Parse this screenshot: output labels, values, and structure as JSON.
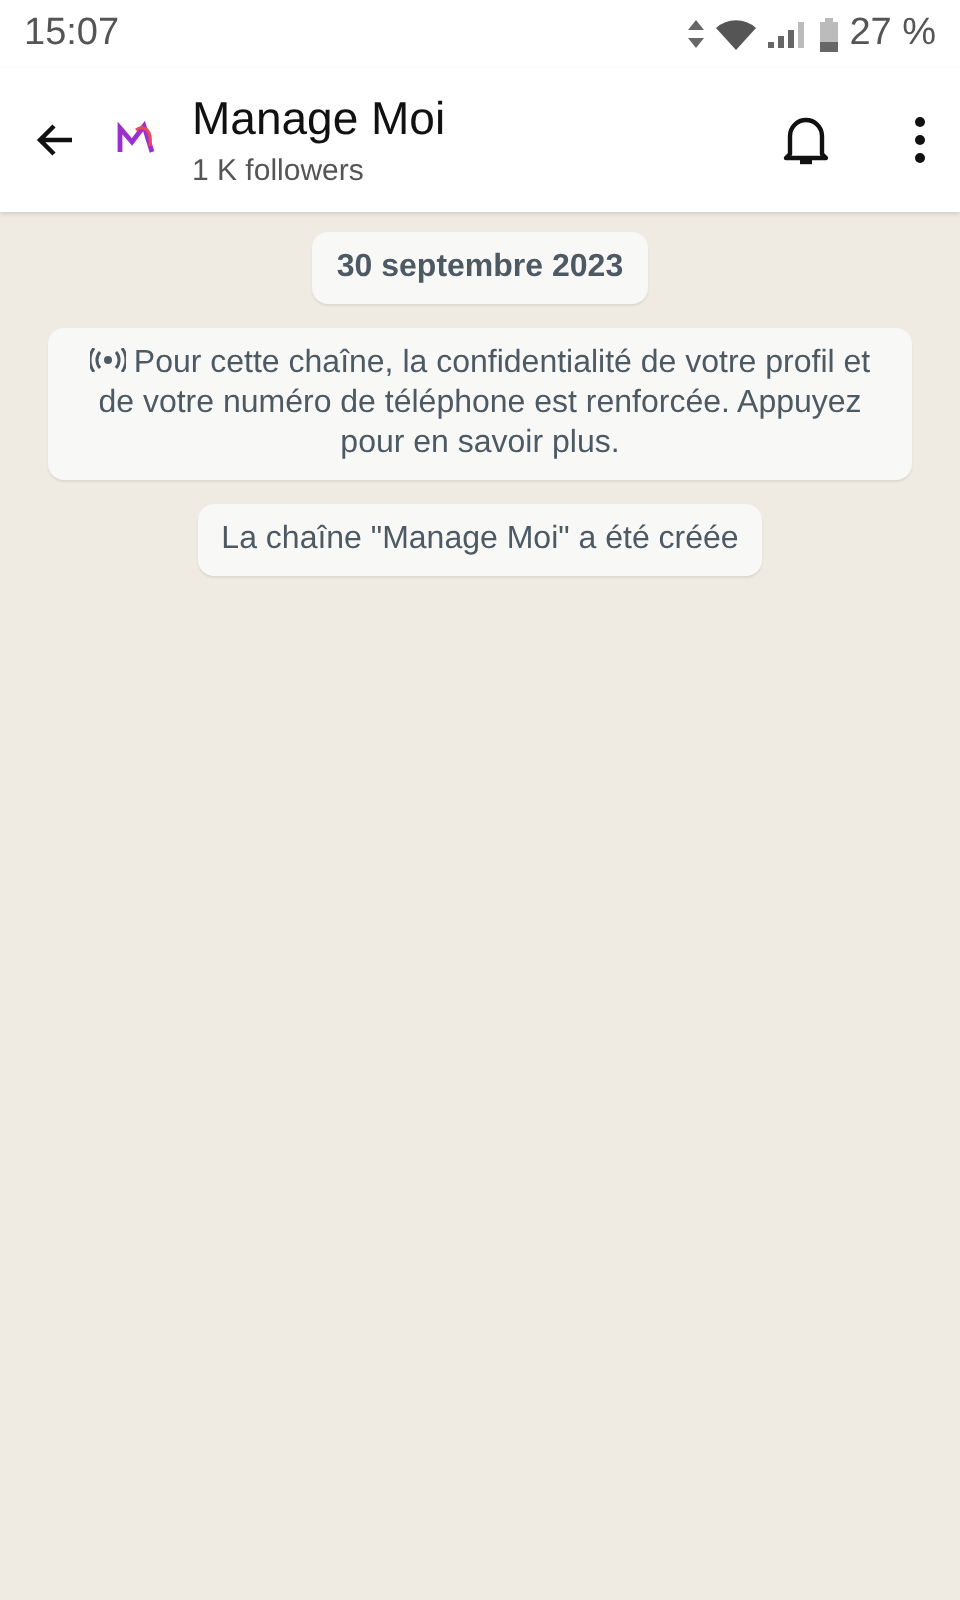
{
  "status_bar": {
    "time": "15:07",
    "battery": "27 %"
  },
  "header": {
    "title": "Manage Moi",
    "subtitle": "1 K followers"
  },
  "messages": [
    {
      "kind": "date",
      "text": "30 septembre 2023"
    },
    {
      "kind": "notice",
      "text": "Pour cette chaîne, la confidentialité de votre profil et de votre numéro de téléphone est renforcée. Appuyez pour en savoir plus."
    },
    {
      "kind": "system",
      "text": "La chaîne \"Manage Moi\" a été créée"
    }
  ]
}
